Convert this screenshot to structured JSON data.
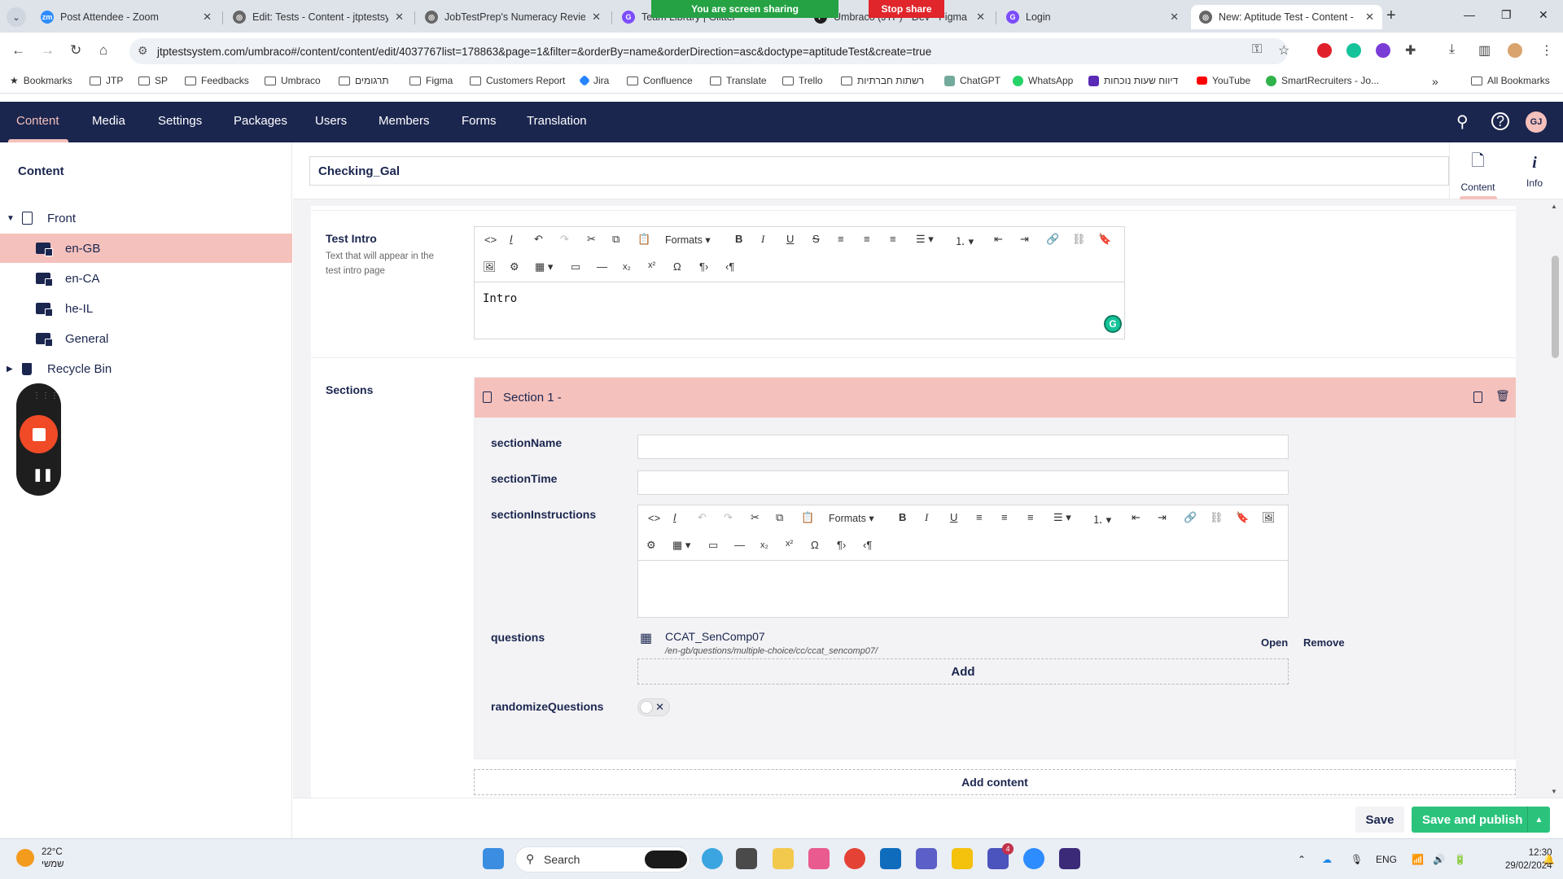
{
  "browser": {
    "tabs": [
      {
        "label": "Post Attendee - Zoom",
        "icon": "zoom-icon",
        "color": "#2d8cff"
      },
      {
        "label": "Edit: Tests - Content - jtptestsys",
        "icon": "globe-icon",
        "color": "#666666"
      },
      {
        "label": "JobTestPrep's Numeracy Review",
        "icon": "globe-icon",
        "color": "#666666"
      },
      {
        "label": "Team Library | Glitter",
        "icon": "g-icon",
        "color": "#7b4dff"
      },
      {
        "label": "Umbraco (JTP) - Dev - Figma",
        "icon": "figma-icon",
        "color": "#1e1e1e"
      },
      {
        "label": "Login",
        "icon": "g-icon",
        "color": "#7b4dff"
      },
      {
        "label": "New: Aptitude Test - Content -",
        "icon": "globe-icon",
        "color": "#666666"
      }
    ],
    "share_banner": "You are screen sharing",
    "stop_share": "Stop share",
    "url": "jtptestsystem.com/umbraco#/content/content/edit/4037767list=178863&page=1&filter=&orderBy=name&orderDirection=asc&doctype=aptitudeTest&create=true",
    "bookmarks": [
      {
        "label": "Bookmarks",
        "icon": "star-icon"
      },
      {
        "label": "JTP",
        "icon": "folder-icon"
      },
      {
        "label": "SP",
        "icon": "folder-icon"
      },
      {
        "label": "Feedbacks",
        "icon": "folder-icon"
      },
      {
        "label": "Umbraco",
        "icon": "folder-icon"
      },
      {
        "label": "תרגומים",
        "icon": "folder-icon"
      },
      {
        "label": "Figma",
        "icon": "folder-icon"
      },
      {
        "label": "Customers Report",
        "icon": "folder-icon"
      },
      {
        "label": "Jira",
        "icon": "jira-icon"
      },
      {
        "label": "Confluence",
        "icon": "folder-icon"
      },
      {
        "label": "Translate",
        "icon": "folder-icon"
      },
      {
        "label": "Trello",
        "icon": "folder-icon"
      },
      {
        "label": "רשתות חברתיות",
        "icon": "folder-icon"
      },
      {
        "label": "ChatGPT",
        "icon": "chatgpt-icon"
      },
      {
        "label": "WhatsApp",
        "icon": "whatsapp-icon"
      },
      {
        "label": "דיווח שעות נוכחות",
        "icon": "report-icon"
      },
      {
        "label": "YouTube",
        "icon": "youtube-icon"
      },
      {
        "label": "SmartRecruiters - Jo...",
        "icon": "smartrecruiters-icon"
      }
    ],
    "all_bookmarks": "All Bookmarks"
  },
  "umbraco": {
    "nav": [
      "Content",
      "Media",
      "Settings",
      "Packages",
      "Users",
      "Members",
      "Forms",
      "Translation"
    ],
    "avatar_initials": "GJ",
    "sidebar": {
      "title": "Content",
      "tree": [
        {
          "label": "Front",
          "level": 0,
          "icon": "document-icon"
        },
        {
          "label": "en-GB",
          "level": 1,
          "icon": "folder-icon",
          "selected": true
        },
        {
          "label": "en-CA",
          "level": 1,
          "icon": "folder-icon"
        },
        {
          "label": "he-IL",
          "level": 1,
          "icon": "folder-icon"
        },
        {
          "label": "General",
          "level": 1,
          "icon": "folder-icon"
        },
        {
          "label": "Recycle Bin",
          "level": 0,
          "icon": "trash-icon"
        }
      ]
    },
    "node_name": "Checking_Gal",
    "apps": [
      {
        "label": "Content",
        "icon": "document-icon",
        "active": true
      },
      {
        "label": "Info",
        "icon": "info-icon"
      }
    ],
    "test_intro": {
      "label": "Test Intro",
      "description": "Text that will appear in the test intro page",
      "formats_label": "Formats",
      "value": "Intro"
    },
    "sections": {
      "label": "Sections",
      "block_title": "Section 1 -",
      "fields": {
        "section_name": "sectionName",
        "section_time": "sectionTime",
        "section_instructions": "sectionInstructions",
        "questions": "questions",
        "randomize": "randomizeQuestions"
      },
      "question": {
        "name": "CCAT_SenComp07",
        "path": "/en-gb/questions/multiple-choice/cc/ccat_sencomp07/",
        "open": "Open",
        "remove": "Remove"
      },
      "add_label": "Add",
      "randomize_on": false,
      "add_content_label": "Add content"
    },
    "footer": {
      "save": "Save",
      "save_publish": "Save and publish"
    },
    "colors": {
      "header": "#1b264f",
      "accent": "#f5c1bc",
      "publish": "#2bc37c"
    }
  },
  "taskbar": {
    "temperature": "22°C",
    "weather_label": "שמשי",
    "search_placeholder": "Search",
    "lang": "ENG",
    "time": "12:30",
    "date": "29/02/2024",
    "teams_badge": "4"
  }
}
